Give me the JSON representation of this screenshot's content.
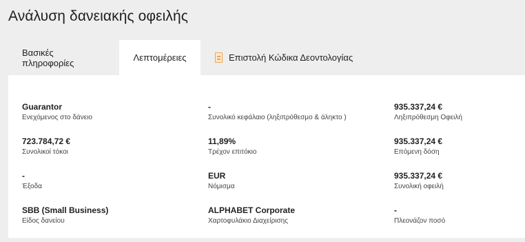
{
  "page": {
    "title": "Ανάλυση δανειακής οφειλής"
  },
  "tabs": [
    {
      "label": "Βασικές πληροφορίες",
      "active": false
    },
    {
      "label": "Λεπτομέρειες",
      "active": true
    },
    {
      "label": "Επιστολή Κώδικα Δεοντολογίας",
      "active": false,
      "icon": "document-icon"
    }
  ],
  "details": {
    "guarantor": {
      "value": "Guarantor",
      "label": "Ενεχόμενος στο δάνειο"
    },
    "total_capital": {
      "value": "-",
      "label": "Συνολικό κεφάλαιο (ληξιπρόθεσμο & άληκτο )"
    },
    "overdue_debt": {
      "value": "935.337,24 €",
      "label": "Ληξιπρόθεσμη Οφειλή"
    },
    "total_interest": {
      "value": "723.784,72 €",
      "label": "Συνολικοί τόκοι"
    },
    "current_rate": {
      "value": "11,89%",
      "label": "Τρέχον επιτόκιο"
    },
    "next_installment": {
      "value": "935.337,24 €",
      "label": "Επόμενη δόση"
    },
    "expenses": {
      "value": "-",
      "label": "Έξοδα"
    },
    "currency": {
      "value": "EUR",
      "label": "Νόμισμα"
    },
    "total_debt": {
      "value": "935.337,24 €",
      "label": "Συνολική οφειλή"
    },
    "loan_type": {
      "value": "SBB (Small Business)",
      "label": "Είδος δανείου"
    },
    "portfolio": {
      "value": "ALPHABET Corporate",
      "label": "Χαρτοφυλάκιο Διαχείρισης"
    },
    "surplus": {
      "value": "-",
      "label": "Πλεονάζον ποσό"
    }
  },
  "colors": {
    "background": "#eeeeee",
    "panel": "#ffffff",
    "icon_accent": "#f0a34a"
  }
}
